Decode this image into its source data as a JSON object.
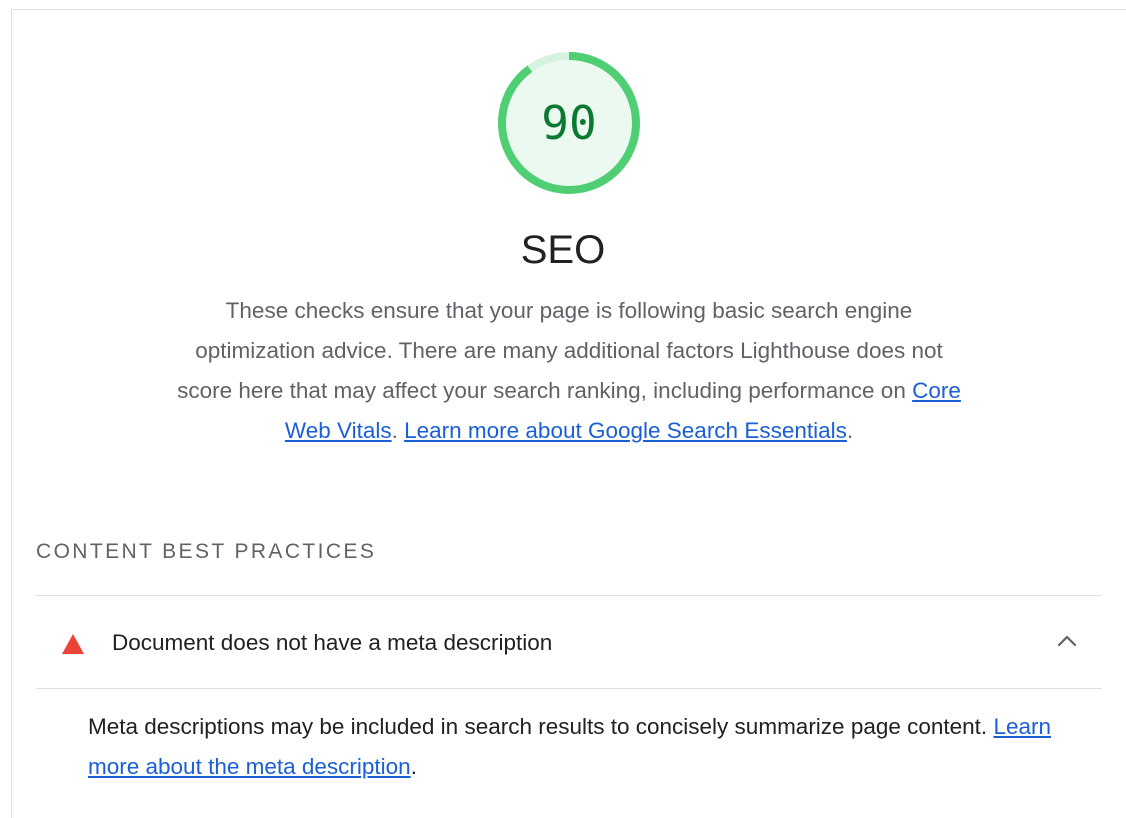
{
  "category": {
    "score": "90",
    "score_fraction": 0.9,
    "score_color": "#0cce6b",
    "title": "SEO",
    "description_part1": "These checks ensure that your page is following basic search engine optimization advice. There are many additional factors Lighthouse does not score here that may affect your search ranking, including performance on ",
    "link_core_web_vitals": "Core Web Vitals",
    "description_sep": ". ",
    "link_learn_more": "Learn more about Google Search Essentials",
    "description_end": "."
  },
  "group": {
    "title": "CONTENT BEST PRACTICES"
  },
  "audit": {
    "icon": "fail-triangle-icon",
    "icon_color": "#eb4335",
    "title": "Document does not have a meta description",
    "expanded": true,
    "description_part1": "Meta descriptions may be included in search results to concisely summarize page content. ",
    "link_learn_more": "Learn more about the meta description",
    "description_end": "."
  },
  "colors": {
    "link": "#1a5fd6",
    "pass_green": "#0cce6b",
    "fail_red": "#eb4335"
  }
}
